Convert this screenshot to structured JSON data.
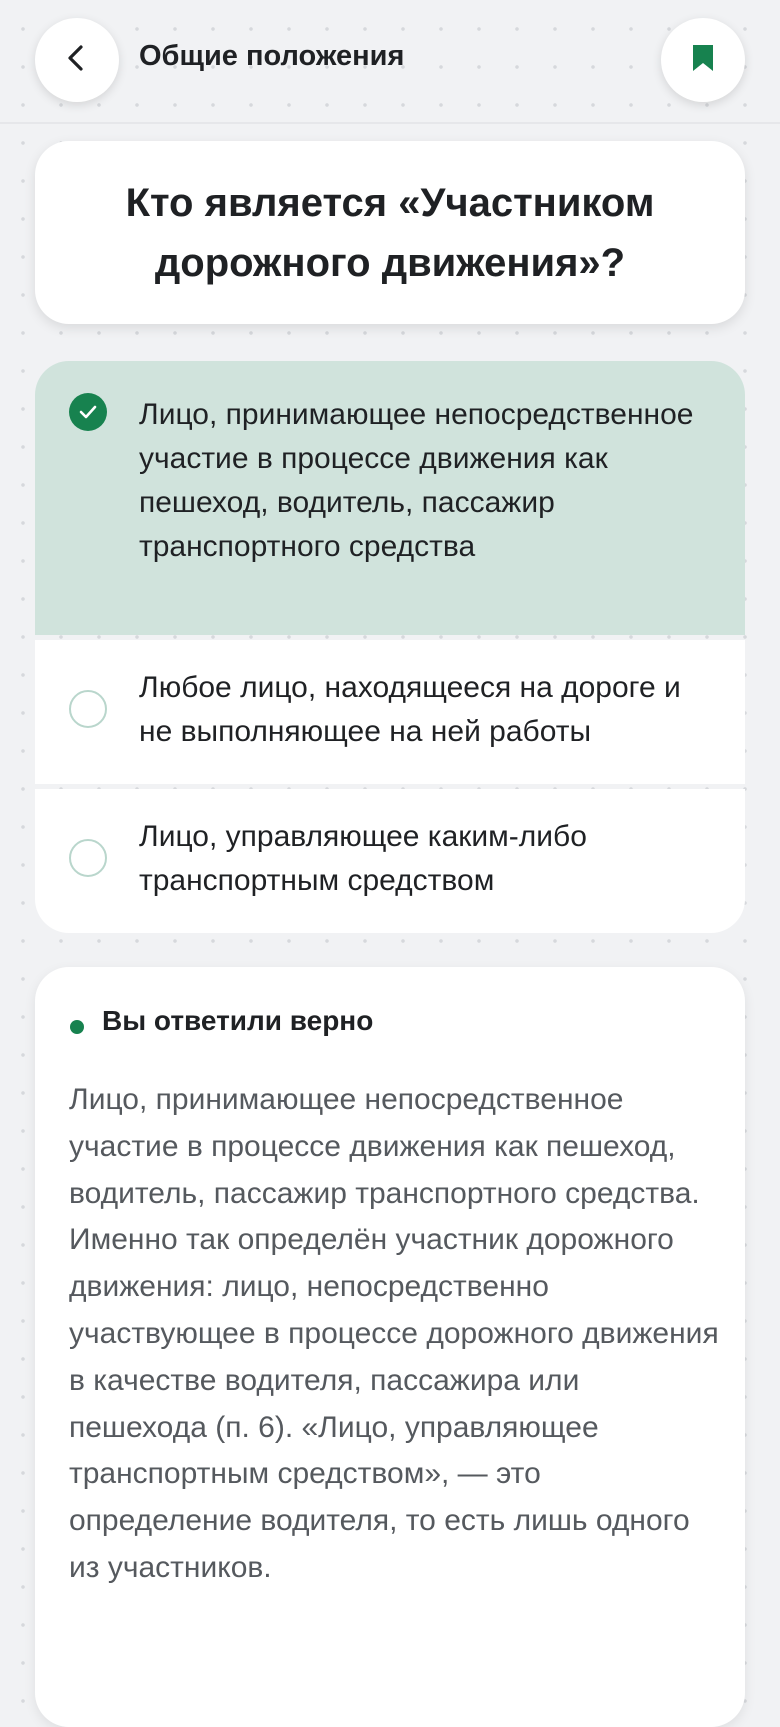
{
  "header": {
    "back_icon": "chevron-left-icon",
    "title": "Общие положения",
    "bookmark_icon": "bookmark-icon",
    "accent_color": "#17824f"
  },
  "question": {
    "text": "Кто является «Участником дорожного движения»?"
  },
  "answers": [
    {
      "text": "Лицо, принимающее непосредственное участие в процессе движения как пешеход, водитель, пассажир транспортного средства",
      "selected": true,
      "icon": "check-circle-icon"
    },
    {
      "text": "Любое лицо, находящееся на дороге и не выполняющее на ней работы",
      "selected": false,
      "icon": "radio-empty-icon"
    },
    {
      "text": "Лицо, управляющее каким-либо транспортным средством",
      "selected": false,
      "icon": "radio-empty-icon"
    }
  ],
  "result": {
    "status": "Вы ответили верно",
    "explanation": "Лицо, принимающее непосредственное участие в процессе движения как пешеход, водитель, пассажир транспортного средства. Именно так определён участник дорожного движения: лицо, непосредственно участвующее в процессе дорожного движения в качестве водителя, пассажира или пешехода (п. 6). «Лицо, управляющее транспортным средством», — это определение водителя, то есть лишь одного из участников."
  },
  "colors": {
    "selected_background": "#d0e3dc",
    "success": "#17824f"
  }
}
